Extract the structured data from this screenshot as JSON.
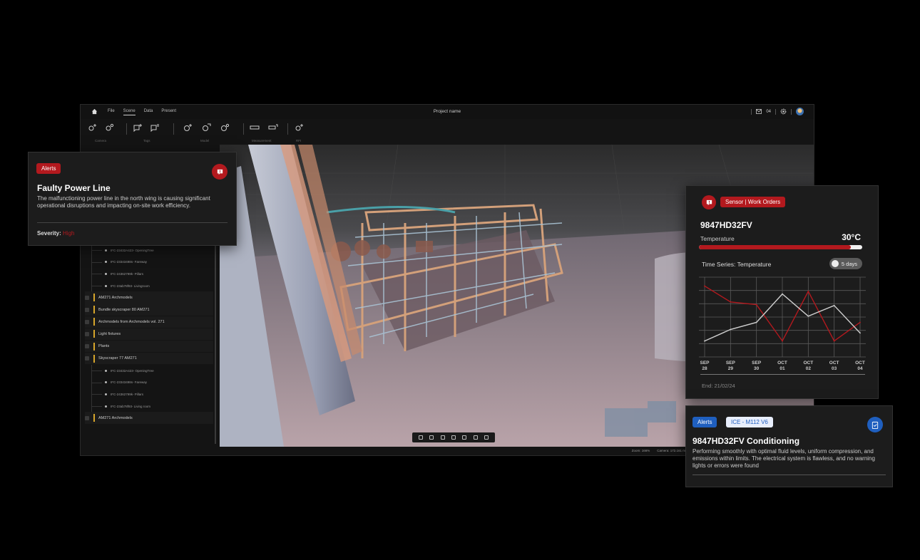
{
  "app": {
    "menu": [
      "File",
      "Scene",
      "Data",
      "Present"
    ],
    "active_menu": "Scene",
    "project_name": "Project name",
    "message_count": "04",
    "toolbar_groups": [
      "Camera",
      "Tags",
      "Model",
      "Measurement",
      "RFI"
    ],
    "status": {
      "zoom": "Zoom: 166%",
      "camera": "Camera: 172.161 m"
    }
  },
  "tree": {
    "items": [
      {
        "type": "sub",
        "label": "IFC-23432A423- OpeningTree"
      },
      {
        "type": "sub",
        "label": "IFC-23343498s- Fareway"
      },
      {
        "type": "sub",
        "label": "IFC-24362799k- Pillars"
      },
      {
        "type": "sub",
        "label": "IFC-23ab78f93- Livingroom"
      },
      {
        "type": "group",
        "label": "AM271 Archmodels"
      },
      {
        "type": "group",
        "label": "Bundle skyscraper 80 AM271"
      },
      {
        "type": "group",
        "label": "Archmodels from Archmodels vol. 271"
      },
      {
        "type": "group",
        "label": "Light fixtures"
      },
      {
        "type": "group",
        "label": "Plants"
      },
      {
        "type": "group",
        "label": "Skyscraper 77 AM271"
      },
      {
        "type": "sub",
        "label": "IFC-23432A423- OpeningTree"
      },
      {
        "type": "sub",
        "label": "IFC-23343498s- Fareway"
      },
      {
        "type": "sub",
        "label": "IFC-24362799k- Pillars"
      },
      {
        "type": "sub",
        "label": "IFC-23ab78f93- Living room"
      },
      {
        "type": "group",
        "label": "AM271 Archmodels"
      }
    ]
  },
  "alert": {
    "tag": "Alerts",
    "title": "Faulty Power Line",
    "description": "The malfunctioning power line in the north wing is causing significant operational disruptions and impacting on-site work efficiency.",
    "severity_label": "Severity:",
    "severity_value": "High"
  },
  "sensor": {
    "tag": "Sensor | Work Orders",
    "id": "9847HD32FV",
    "temperature_label": "Temperature",
    "temperature_value": "30°C",
    "temperature_fraction": 0.93,
    "series_title": "Time Series: Temperature",
    "range": "5 days",
    "end": "End: 21/02/24",
    "colors": {
      "red": "#b3191e"
    }
  },
  "chart_data": {
    "type": "line",
    "categories": [
      "SEP 28",
      "SEP 29",
      "SEP 30",
      "OCT 01",
      "OCT 02",
      "OCT 03",
      "OCT 04"
    ],
    "series": [
      {
        "color": "#b3191e",
        "values": [
          8.0,
          6.2,
          5.9,
          1.8,
          7.4,
          1.8,
          3.9
        ]
      },
      {
        "color": "#cfcfcf",
        "values": [
          1.8,
          3.1,
          3.9,
          7.1,
          4.6,
          5.8,
          2.7
        ]
      }
    ],
    "ylim": [
      0,
      9
    ],
    "grid": true
  },
  "condition": {
    "tag": "Alerts",
    "model": "ICE - M112 V6",
    "title": "9847HD32FV Conditioning",
    "description": "Performing smoothly with optimal fluid levels, uniform compression, and emissions within limits. The electrical system is flawless, and no warning lights or errors were found"
  }
}
